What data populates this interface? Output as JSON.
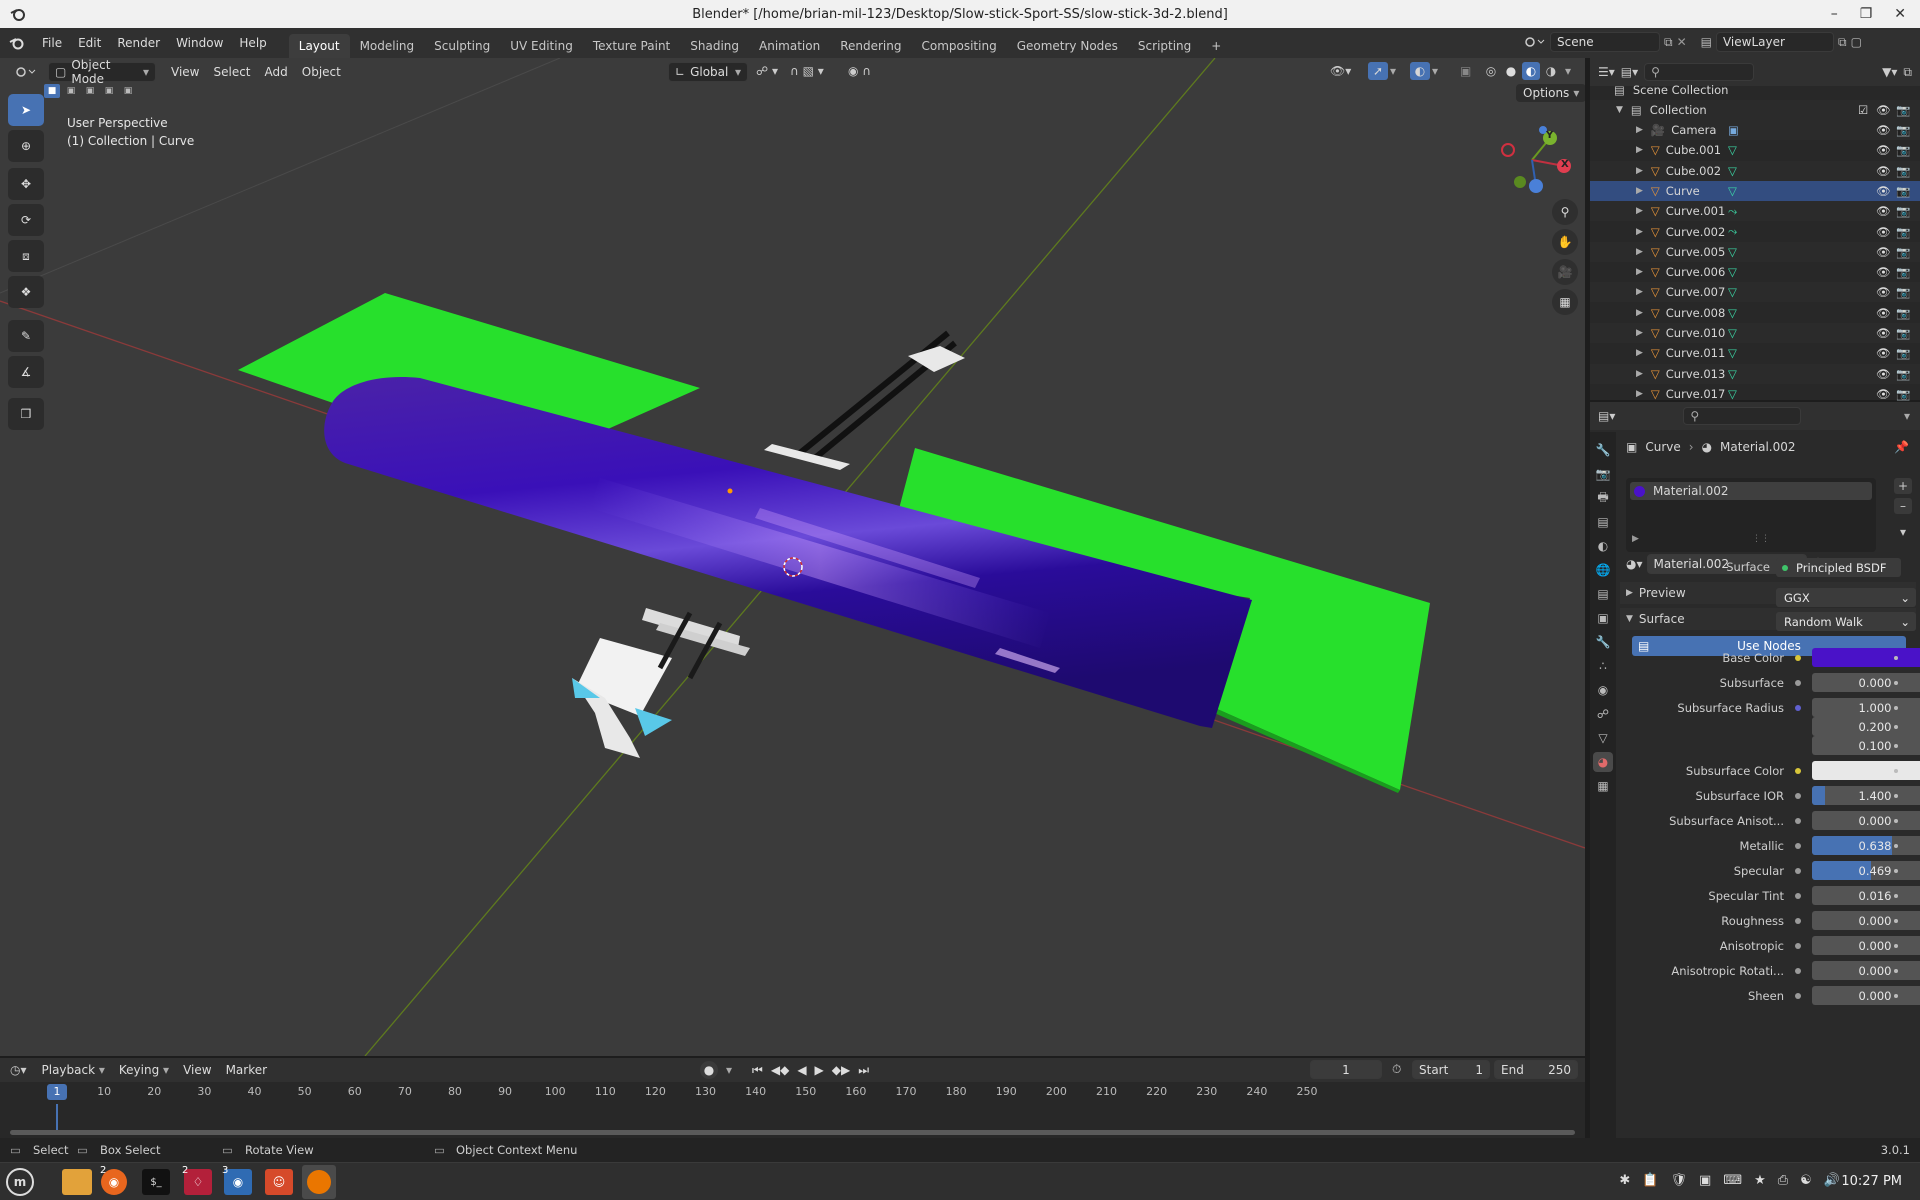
{
  "window": {
    "title": "Blender* [/home/brian-mil-123/Desktop/Slow-stick-Sport-SS/slow-stick-3d-2.blend]"
  },
  "menus": [
    "File",
    "Edit",
    "Render",
    "Window",
    "Help"
  ],
  "workspaces": [
    "Layout",
    "Modeling",
    "Sculpting",
    "UV Editing",
    "Texture Paint",
    "Shading",
    "Animation",
    "Rendering",
    "Compositing",
    "Geometry Nodes",
    "Scripting"
  ],
  "scene": {
    "name": "Scene",
    "view_layer": "ViewLayer"
  },
  "viewport": {
    "mode": "Object Mode",
    "menus": [
      "View",
      "Select",
      "Add",
      "Object"
    ],
    "transform_orientation": "Global",
    "options": "Options",
    "overlay_title": "User Perspective",
    "overlay_subtitle": "(1) Collection | Curve",
    "gizmo_axes": [
      "Y",
      "X"
    ]
  },
  "outliner": {
    "root": "Scene Collection",
    "collection": "Collection",
    "items": [
      "Camera",
      "Cube.001",
      "Cube.002",
      "Curve",
      "Curve.001",
      "Curve.002",
      "Curve.005",
      "Curve.006",
      "Curve.007",
      "Curve.008",
      "Curve.010",
      "Curve.011",
      "Curve.013",
      "Curve.017"
    ]
  },
  "properties": {
    "breadcrumb_object": "Curve",
    "breadcrumb_material": "Material.002",
    "slot": "Material.002",
    "material_name": "Material.002",
    "panel_preview": "Preview",
    "panel_surface": "Surface",
    "use_nodes": "Use Nodes",
    "surface_label": "Surface",
    "surface_shader": "Principled BSDF",
    "distribution": "GGX",
    "subsurface_method": "Random Walk",
    "fields": [
      {
        "label": "Base Color",
        "kind": "color",
        "color": "#4a12c8"
      },
      {
        "label": "Subsurface",
        "value": "0.000"
      },
      {
        "label": "Subsurface Radius",
        "value": "1.000"
      },
      {
        "label": "",
        "value": "0.200"
      },
      {
        "label": "",
        "value": "0.100"
      },
      {
        "label": "Subsurface Color",
        "kind": "color",
        "color": "#e8e8e8"
      },
      {
        "label": "Subsurface IOR",
        "value": "1.400",
        "fill": 0.1
      },
      {
        "label": "Subsurface Anisot...",
        "value": "0.000"
      },
      {
        "label": "Metallic",
        "value": "0.638",
        "fill": 0.638
      },
      {
        "label": "Specular",
        "value": "0.469",
        "fill": 0.469
      },
      {
        "label": "Specular Tint",
        "value": "0.016"
      },
      {
        "label": "Roughness",
        "value": "0.000"
      },
      {
        "label": "Anisotropic",
        "value": "0.000"
      },
      {
        "label": "Anisotropic Rotati...",
        "value": "0.000"
      },
      {
        "label": "Sheen",
        "value": "0.000"
      }
    ]
  },
  "timeline": {
    "menus": [
      "Playback",
      "Keying",
      "View",
      "Marker"
    ],
    "current_frame": "1",
    "start_label": "Start",
    "start": "1",
    "end_label": "End",
    "end": "250",
    "ruler": [
      "1",
      "10",
      "20",
      "30",
      "40",
      "50",
      "60",
      "70",
      "80",
      "90",
      "100",
      "110",
      "120",
      "130",
      "140",
      "150",
      "160",
      "170",
      "180",
      "190",
      "200",
      "210",
      "220",
      "230",
      "240",
      "250"
    ]
  },
  "statusbar": {
    "select": "Select",
    "box_select": "Box Select",
    "rotate_view": "Rotate View",
    "context_menu": "Object Context Menu",
    "version": "3.0.1"
  },
  "taskbar": {
    "clock": "10:27 PM",
    "badges": [
      "2",
      "2",
      "3"
    ]
  }
}
